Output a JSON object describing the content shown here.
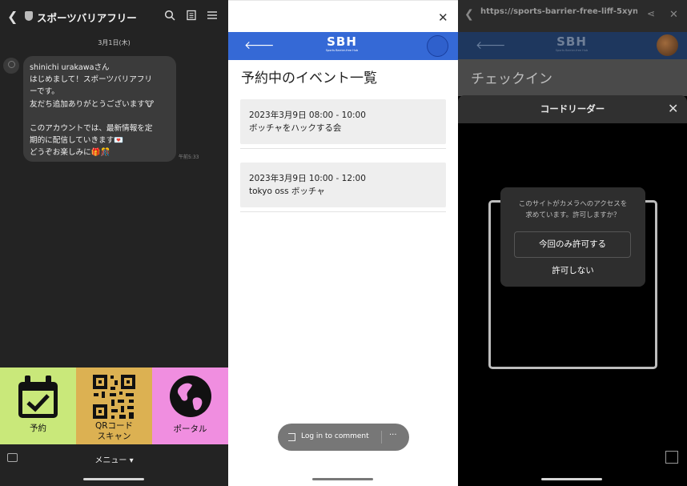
{
  "chat": {
    "header_title": "スポーツバリアフリー",
    "date": "3月1日(木)",
    "message": "shinichi urakawaさん\nはじめまして！スポーツバリアフリ\nーです。\n友だち追加ありがとうございます🐮\n\nこのアカウントでは、最新情報を定\n期的に配信していきます💌\nどうぞお楽しみに🎁🎊",
    "time": "午前5:33",
    "rich_menu": [
      {
        "label": "予約",
        "color": "#c9e87a",
        "icon": "calendar-check-icon"
      },
      {
        "label": "QRコード\nスキャン",
        "color": "#dcb152",
        "icon": "qr-code-icon"
      },
      {
        "label": "ポータル",
        "color": "#f08ee0",
        "icon": "globe-icon"
      }
    ],
    "menu_label": "メニュー ▾"
  },
  "reservations": {
    "logo": "SBH",
    "logo_sub": "Sports Barrier-free Hub",
    "title": "予約中のイベント一覧",
    "events": [
      {
        "datetime": "2023年3月9日 08:00 - 10:00",
        "name": "ボッチャをハックする会"
      },
      {
        "datetime": "2023年3月9日 10:00 - 12:00",
        "name": "tokyo oss ボッチャ"
      }
    ],
    "login_label": "Log in to comment",
    "more_label": "···"
  },
  "checkin": {
    "url": "https://sports-barrier-free-liff-5xyn-...",
    "logo": "SBH",
    "logo_sub": "Sports Barrier-free Hub",
    "page_title": "チェックイン",
    "modal_title": "コードリーダー",
    "permission_message": "このサイトがカメラへのアクセスを\n求めています。許可しますか？",
    "allow_once": "今回のみ許可する",
    "deny": "許可しない"
  }
}
